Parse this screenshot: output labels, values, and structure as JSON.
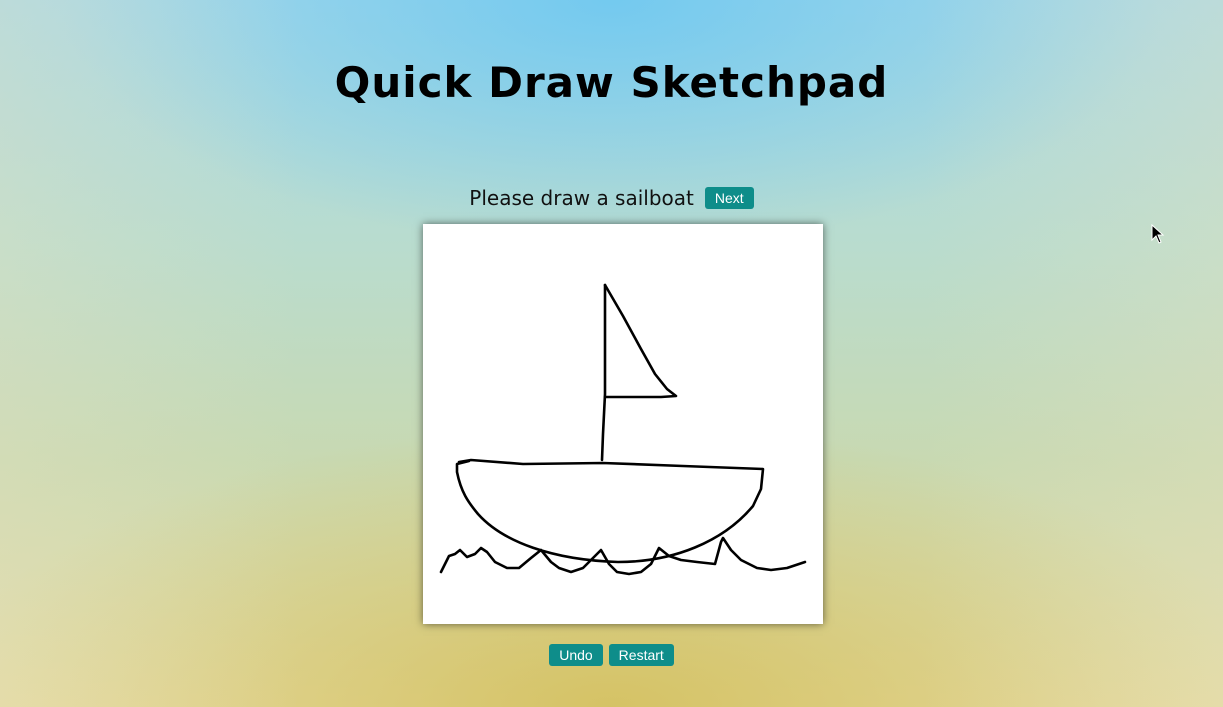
{
  "app": {
    "title": "Quick Draw Sketchpad"
  },
  "prompt": {
    "text": "Please draw a sailboat",
    "next_label": "Next"
  },
  "controls": {
    "undo_label": "Undo",
    "restart_label": "Restart"
  },
  "colors": {
    "button": "#0e8d8a",
    "stroke": "#000000",
    "canvas": "#ffffff"
  }
}
